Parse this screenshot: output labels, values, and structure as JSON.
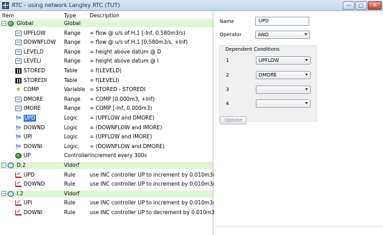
{
  "window": {
    "title": "RTC - using network Langley RTC (TUT)",
    "buttons": {
      "minimize": "—",
      "maximize": "□",
      "close": "✕"
    }
  },
  "columns": [
    "Item",
    "Type",
    "Description"
  ],
  "rows": [
    {
      "name": "Global",
      "type": "Global",
      "desc": "",
      "icon": "globe-icon",
      "kind": "group",
      "indent": 0
    },
    {
      "name": "UPFLOW",
      "type": "Range",
      "desc": "= flow @ u/s of H.1 [-Inf, 0.580m3/s)",
      "icon": "range-icon",
      "indent": 1
    },
    {
      "name": "DOWNFLOW",
      "type": "Range",
      "desc": "= flow @ u/s of H.1 [0.580m3/s, +Inf)",
      "icon": "range-icon",
      "indent": 1
    },
    {
      "name": "LEVELD",
      "type": "Range",
      "desc": "= height above datum @ D",
      "icon": "range-icon",
      "indent": 1
    },
    {
      "name": "LEVELI",
      "type": "Range",
      "desc": "= height above datum @ I",
      "icon": "range-icon",
      "indent": 1
    },
    {
      "name": "STORED",
      "type": "Table",
      "desc": "= f(LEVELD)",
      "icon": "table-icon",
      "indent": 1
    },
    {
      "name": "STOREDI",
      "type": "Table",
      "desc": "= f(LEVELI)",
      "icon": "table-icon",
      "indent": 1
    },
    {
      "name": "COMP",
      "type": "Variable",
      "desc": "= STORED - STOREDI",
      "icon": "variable-star-icon",
      "indent": 1
    },
    {
      "name": "DMORE",
      "type": "Range",
      "desc": "= COMP [0.000m3, +Inf)",
      "icon": "range-icon",
      "indent": 1
    },
    {
      "name": "IMORE",
      "type": "Range",
      "desc": "= COMP [-Inf, 0.000m3)",
      "icon": "range-icon",
      "indent": 1
    },
    {
      "name": "UPD",
      "type": "Logic",
      "desc": "= (UPFLOW and DMORE)",
      "icon": "logic-icon",
      "indent": 1,
      "selected": true
    },
    {
      "name": "DOWND",
      "type": "Logic",
      "desc": "= (DOWNFLOW and IMORE)",
      "icon": "logic-icon",
      "indent": 1
    },
    {
      "name": "UPI",
      "type": "Logic",
      "desc": "= (UPFLOW and IMORE)",
      "icon": "logic-icon",
      "indent": 1
    },
    {
      "name": "DOWNI",
      "type": "Logic",
      "desc": "= (DOWNFLOW and DMORE)",
      "icon": "logic-icon",
      "indent": 1
    },
    {
      "name": "UP",
      "type": "Controller",
      "desc": "increment every 300s",
      "icon": "controller-icon",
      "indent": 1
    },
    {
      "name": "D.2",
      "type": "Vldorf",
      "desc": "",
      "icon": "node-icon",
      "kind": "group",
      "indent": 0
    },
    {
      "name": "UPD",
      "type": "Rule",
      "desc": "use INC controller UP to increment by 0.010m3/s",
      "icon": "rule-icon",
      "indent": 1
    },
    {
      "name": "DOWND",
      "type": "Rule",
      "desc": "use INC controller UP to increment by 0.010m3/s",
      "icon": "rule-icon",
      "indent": 1
    },
    {
      "name": "I.2",
      "type": "Vldorf",
      "desc": "",
      "icon": "node-icon",
      "kind": "group",
      "indent": 0
    },
    {
      "name": "UPI",
      "type": "Rule",
      "desc": "use INC controller UP to increment by 0.010m3/s",
      "icon": "rule-icon",
      "indent": 1
    },
    {
      "name": "DOWNI",
      "type": "Rule",
      "desc": "use INC controller UP to decrement by 0.010m3/s",
      "icon": "rule-icon",
      "indent": 1
    }
  ],
  "details": {
    "name_label": "Name",
    "name_value": "UPD",
    "operator_label": "Operator",
    "operator_value": "AND",
    "dependent_label": "Dependent Conditions",
    "conditions": [
      {
        "num": "1",
        "value": "UPFLOW"
      },
      {
        "num": "2",
        "value": "DMORE"
      },
      {
        "num": "3",
        "value": ""
      },
      {
        "num": "4",
        "value": ""
      }
    ],
    "update_label": "Update"
  },
  "colors": {
    "selection": "#3a7bd5",
    "group_row": "#dff6d5",
    "titlebar": "#c4d6ee",
    "close_button": "#c1452c"
  }
}
